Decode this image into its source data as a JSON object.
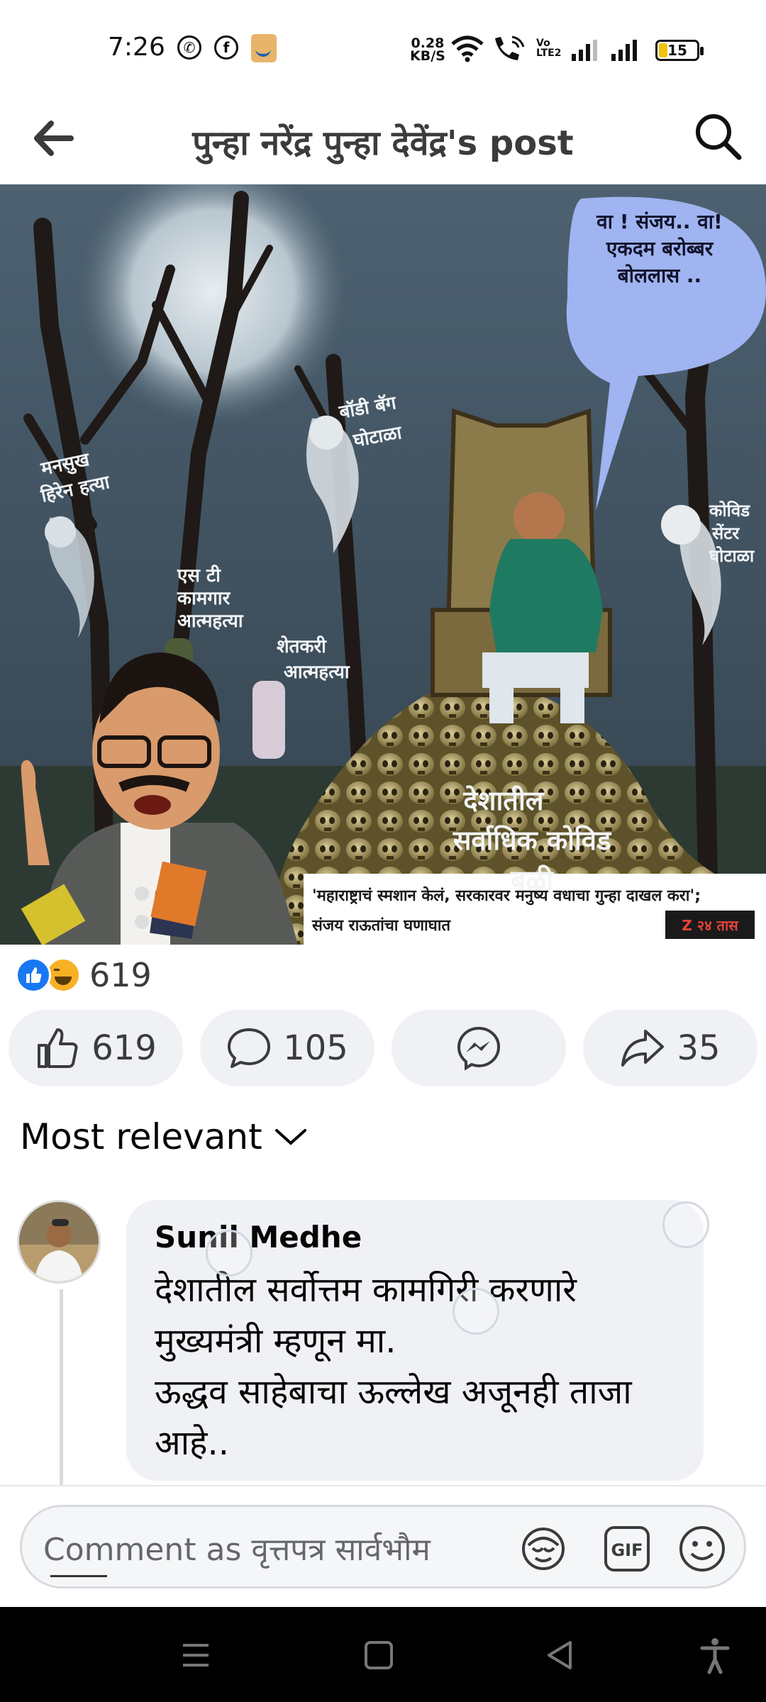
{
  "status_bar": {
    "time": "7:26",
    "net_speed_value": "0.28",
    "net_speed_unit": "KB/S",
    "volte_top": "Vo",
    "volte_bottom": "LTE2",
    "battery": "15",
    "notification_icons": [
      "whatsapp-icon",
      "facebook-icon",
      "amazon-icon"
    ]
  },
  "header": {
    "title": "पुन्हा नरेंद्र पुन्हा देवेंद्र's post",
    "back_icon": "back-arrow-icon",
    "search_icon": "search-icon"
  },
  "post_image": {
    "speech_bubble": [
      "वा ! संजय.. वा!",
      "एकदम बरोब्बर",
      "बोललास .."
    ],
    "label_mansukh": [
      "मनसुख",
      "हिरेन हत्या"
    ],
    "label_st_workers": [
      "एस टी",
      "कामगार",
      "आत्महत्या"
    ],
    "label_body_bag": [
      "बॉडी बॅग",
      "घोटाळा"
    ],
    "label_farmer": [
      "शेतकरी",
      "आत्महत्या"
    ],
    "label_covid_center": [
      "कोविड",
      "सेंटर",
      "घोटाळा"
    ],
    "label_skull_pile": [
      "देशातील",
      "सर्वाधिक कोविड",
      "बळी"
    ],
    "caption": [
      "'महाराष्ट्राचं स्मशान केलं, सरकारवर मनुष्य वधाचा गुन्हा दाखल करा';",
      "संजय राऊतांचा घणाघात"
    ],
    "watermark": "Z २४ तास"
  },
  "reactions": {
    "count": "619",
    "types": [
      "like",
      "haha"
    ]
  },
  "actions": {
    "like_count": "619",
    "comment_count": "105",
    "share_count": "35"
  },
  "sort": {
    "label": "Most relevant"
  },
  "comment": {
    "author": "Sunil Medhe",
    "text": "देशातील सर्वोत्तम कामगिरी करणारे\nमुख्यमंत्री म्हणून मा.\nऊद्धव साहेबाचा ऊल्लेख अजूनही ताजा\nआहे.."
  },
  "composer": {
    "placeholder": "Comment as वृत्तपत्र सार्वभौम"
  },
  "colors": {
    "accent_blue": "#1877f2",
    "haha_yellow": "#f7b125",
    "button_bg": "#eff1f4",
    "nav_bg": "#000000"
  }
}
